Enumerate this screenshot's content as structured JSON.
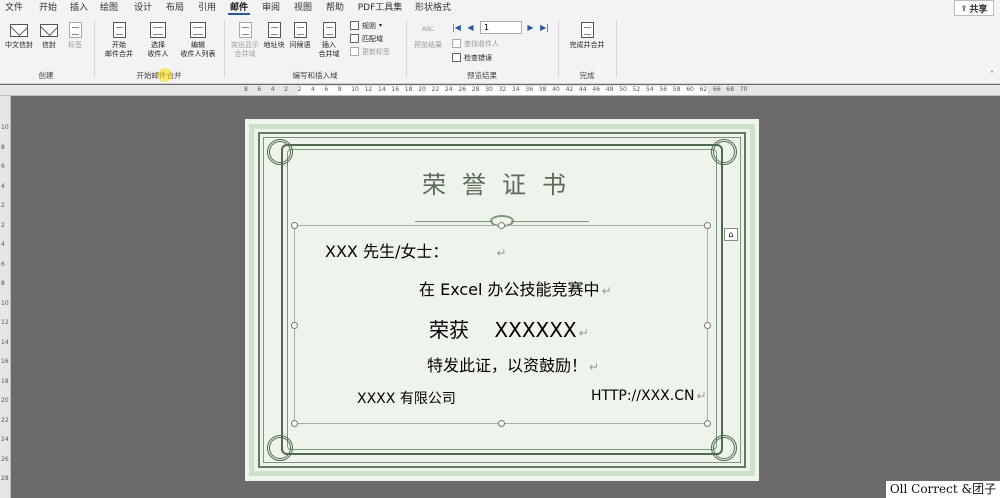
{
  "tabs": [
    "文件",
    "开始",
    "插入",
    "绘图",
    "设计",
    "布局",
    "引用",
    "邮件",
    "审阅",
    "视图",
    "帮助",
    "PDF工具集",
    "形状格式"
  ],
  "active_tab": "邮件",
  "share_label": "共享",
  "ribbon": {
    "create": {
      "label": "创建",
      "envelope": "中文信封",
      "envelope2": "信封",
      "labels": "标签"
    },
    "start": {
      "label": "开始邮件合并",
      "start_btn": "开始",
      "start_btn2": "邮件合并",
      "select_btn": "选择",
      "select_btn2": "收件人",
      "edit_btn": "编辑",
      "edit_btn2": "收件人列表"
    },
    "write": {
      "label": "编写和插入域",
      "highlight": "突出显示",
      "highlight2": "合并域",
      "address": "地址块",
      "greeting": "问候语",
      "insert": "插入",
      "insert2": "合并域",
      "rules": "规则",
      "match": "匹配域",
      "update": "更新标签"
    },
    "preview": {
      "label": "预览结果",
      "preview_btn": "预览结果",
      "abc": "ABC",
      "find": "查找收件人",
      "check": "检查错误",
      "record": "1"
    },
    "finish": {
      "label": "完成",
      "finish_btn": "完成并合并"
    }
  },
  "hruler_marks": [
    "8",
    "6",
    "4",
    "2",
    "2",
    "4",
    "6",
    "8",
    "10",
    "12",
    "14",
    "16",
    "18",
    "20",
    "22",
    "24",
    "26",
    "28",
    "30",
    "32",
    "34",
    "36",
    "38",
    "40",
    "42",
    "44",
    "46",
    "48",
    "50",
    "52",
    "54",
    "56",
    "58",
    "60",
    "62",
    "66",
    "68",
    "70"
  ],
  "vruler_marks": [
    "10",
    "8",
    "6",
    "4",
    "2",
    "2",
    "4",
    "6",
    "8",
    "10",
    "12",
    "14",
    "16",
    "18",
    "20",
    "22",
    "24",
    "26",
    "28"
  ],
  "certificate": {
    "title": "荣誉证书",
    "recipient_line": "XXX  先生/女士：",
    "event_line": "在 Excel 办公技能竞赛中",
    "award_line": "荣获    XXXXXX",
    "closing_line": "特发此证，以资鼓励！",
    "company": "XXXX 有限公司",
    "url": "HTTP://XXX.CN",
    "para_mark": "↵"
  },
  "watermark": "Oll Correct &团子"
}
